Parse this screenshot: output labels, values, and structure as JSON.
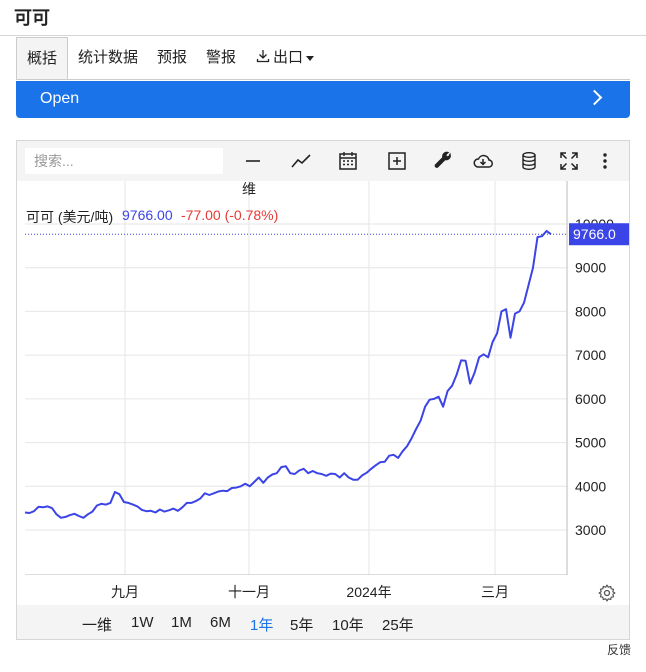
{
  "page": {
    "title": "可可"
  },
  "tabs": [
    {
      "label": "概括",
      "active": true
    },
    {
      "label": "统计数据"
    },
    {
      "label": "预报"
    },
    {
      "label": "警报"
    },
    {
      "label": "出口",
      "icon": "download-icon",
      "dropdown": true
    }
  ],
  "open_bar": {
    "label": "Open",
    "color": "#1a73e8"
  },
  "chart_toolbar": {
    "search_placeholder": "搜索...",
    "icons": [
      "line-style-icon",
      "chart-type-icon",
      "calendar-icon",
      "add-compare-icon",
      "wrench-icon",
      "cloud-download-icon",
      "database-icon",
      "fullscreen-icon",
      "more-vertical-icon"
    ]
  },
  "legend": {
    "top_label": "维",
    "name": "可可 (美元/吨)",
    "price": "9766.00",
    "change": "-77.00 (-0.78%)",
    "price_color": "#3b44e6",
    "change_color": "#e53935"
  },
  "price_tag": "9766.0",
  "ranges": [
    "一维",
    "1W",
    "1M",
    "6M",
    "1年",
    "5年",
    "10年",
    "25年"
  ],
  "active_range": "1年",
  "settings_icon": "gear-icon",
  "feedback": "反馈",
  "chart_data": {
    "type": "line",
    "title": "",
    "xlabel": "",
    "ylabel": "",
    "x_ticks": [
      "九月",
      "十一月",
      "2024年",
      "三月"
    ],
    "y_ticks": [
      3000,
      4000,
      5000,
      6000,
      7000,
      8000,
      9000,
      10000
    ],
    "ylim": [
      2300,
      10400
    ],
    "line_color": "#3b44e6",
    "grid": true,
    "series": [
      {
        "values": [
          3400,
          3390,
          3430,
          3530,
          3520,
          3540,
          3500,
          3360,
          3280,
          3300,
          3340,
          3370,
          3320,
          3280,
          3360,
          3420,
          3560,
          3600,
          3580,
          3620,
          3870,
          3820,
          3640,
          3620,
          3580,
          3540,
          3460,
          3430,
          3440,
          3400,
          3470,
          3420,
          3450,
          3490,
          3440,
          3520,
          3620,
          3620,
          3660,
          3720,
          3840,
          3800,
          3840,
          3880,
          3900,
          3890,
          3960,
          3970,
          4000,
          4060,
          4000,
          4100,
          4200,
          4080,
          4200,
          4270,
          4300,
          4440,
          4460,
          4300,
          4280,
          4360,
          4400,
          4300,
          4350,
          4300,
          4280,
          4240,
          4290,
          4280,
          4200,
          4300,
          4200,
          4150,
          4150,
          4250,
          4310,
          4400,
          4480,
          4550,
          4560,
          4700,
          4720,
          4650,
          4800,
          4920,
          5100,
          5310,
          5500,
          5820,
          5980,
          6000,
          6050,
          5820,
          6180,
          6300,
          6550,
          6880,
          6870,
          6350,
          6600,
          6950,
          7020,
          6950,
          7300,
          7500,
          8000,
          8050,
          7400,
          7950,
          8000,
          8200,
          8600,
          9000,
          9700,
          9720,
          9840,
          9766
        ]
      }
    ]
  }
}
